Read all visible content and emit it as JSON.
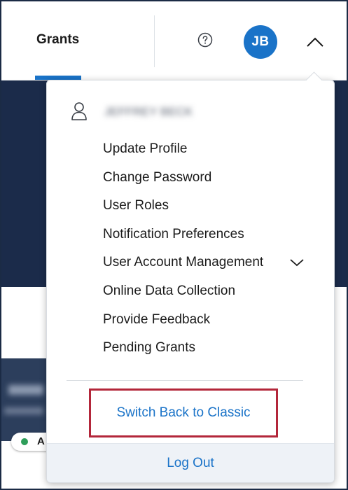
{
  "header": {
    "nav_label": "Grants",
    "avatar_initials": "JB",
    "icons": {
      "help": "help-circle-icon",
      "expand": "chevron-up-icon"
    }
  },
  "background": {
    "status_letter": "A",
    "status_color": "#2e9e5a"
  },
  "user_menu": {
    "user_name": "JEFFREY BECK",
    "items": [
      {
        "label": "Update Profile"
      },
      {
        "label": "Change Password"
      },
      {
        "label": "User Roles"
      },
      {
        "label": "Notification Preferences"
      },
      {
        "label": "User Account Management",
        "expandable": true
      },
      {
        "label": "Online Data Collection"
      },
      {
        "label": "Provide Feedback"
      },
      {
        "label": "Pending Grants"
      }
    ],
    "switch_classic_label": "Switch Back to Classic",
    "logout_label": "Log Out"
  },
  "colors": {
    "accent": "#1a73c8",
    "highlight_border": "#b3263a",
    "hero_background": "#1b2b4a"
  }
}
